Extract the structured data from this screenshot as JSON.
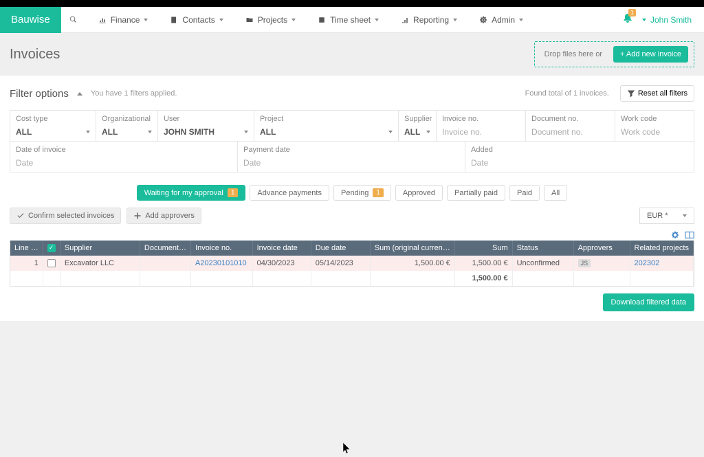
{
  "brand": "Bauwise",
  "nav": {
    "finance": "Finance",
    "contacts": "Contacts",
    "projects": "Projects",
    "timesheet": "Time sheet",
    "reporting": "Reporting",
    "admin": "Admin"
  },
  "top_right": {
    "notif_count": "1",
    "user": "John Smith"
  },
  "header": {
    "page_title": "Invoices",
    "drop_text": "Drop files here or",
    "add_label": "+ Add new invoice"
  },
  "filter": {
    "title": "Filter options",
    "applied": "You have 1 filters applied.",
    "found": "Found total of 1 invoices.",
    "reset": "Reset all filters",
    "cost_type": {
      "label": "Cost type",
      "value": "ALL"
    },
    "org_unit": {
      "label": "Organizational unit",
      "value": "ALL"
    },
    "user": {
      "label": "User",
      "value": "JOHN SMITH"
    },
    "project": {
      "label": "Project",
      "value": "ALL"
    },
    "supplier": {
      "label": "Supplier",
      "value": "ALL"
    },
    "invoice_no": {
      "label": "Invoice no.",
      "placeholder": "Invoice no."
    },
    "document_no": {
      "label": "Document no.",
      "placeholder": "Document no."
    },
    "work_code": {
      "label": "Work code",
      "placeholder": "Work code"
    },
    "date_invoice": {
      "label": "Date of invoice",
      "placeholder": "Date"
    },
    "payment_date": {
      "label": "Payment date",
      "placeholder": "Date"
    },
    "added": {
      "label": "Added",
      "placeholder": "Date"
    }
  },
  "tabs": {
    "waiting": {
      "label": "Waiting for my approval",
      "count": "1"
    },
    "advance": "Advance payments",
    "pending": {
      "label": "Pending",
      "count": "1"
    },
    "approved": "Approved",
    "partially": "Partially paid",
    "paid": "Paid",
    "all": "All"
  },
  "actions": {
    "confirm": "Confirm selected invoices",
    "add_approvers": "Add approvers",
    "currency": "EUR *"
  },
  "table": {
    "headers": {
      "line": "Line …",
      "supplier": "Supplier",
      "document": "Document…",
      "invoice_no": "Invoice no.",
      "invoice_date": "Invoice date",
      "due_date": "Due date",
      "sum_orig": "Sum (original curren…",
      "sum": "Sum",
      "status": "Status",
      "approvers": "Approvers",
      "related": "Related projects"
    },
    "row": {
      "line": "1",
      "supplier": "Excavator LLC",
      "document": "",
      "invoice_no": "A20230101010",
      "invoice_date": "04/30/2023",
      "due_date": "05/14/2023",
      "sum_orig": "1,500.00 €",
      "sum": "1,500.00 €",
      "status": "Unconfirmed",
      "approver_chip": "JS",
      "related": "202302"
    },
    "total": "1,500.00 €"
  },
  "download": "Download filtered data"
}
